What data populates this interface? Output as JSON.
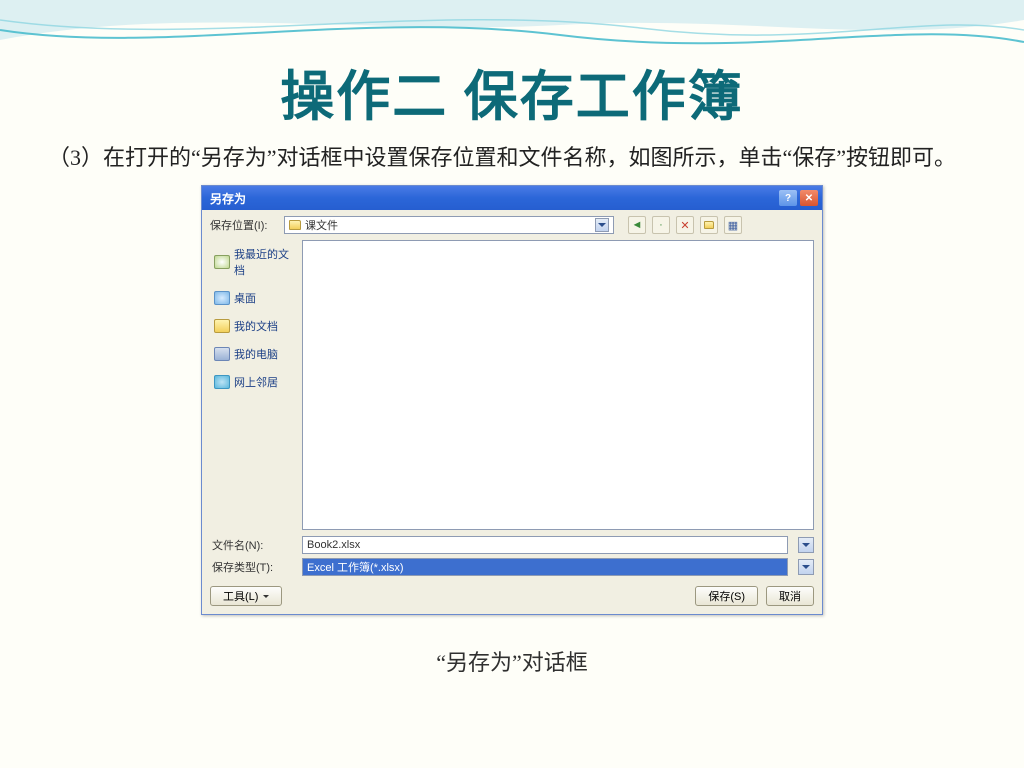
{
  "slide": {
    "title": "操作二 保存工作簿",
    "body": "（3）在打开的“另存为”对话框中设置保存位置和文件名称，如图所示，单击“保存”按钮即可。",
    "caption": "“另存为”对话框"
  },
  "dialog": {
    "title": "另存为",
    "location_label": "保存位置(I):",
    "location_value": "课文件",
    "sidebar": [
      {
        "label": "我最近的文档",
        "icon": "recent"
      },
      {
        "label": "桌面",
        "icon": "desktop"
      },
      {
        "label": "我的文档",
        "icon": "docs"
      },
      {
        "label": "我的电脑",
        "icon": "pc"
      },
      {
        "label": "网上邻居",
        "icon": "net"
      }
    ],
    "filename_label": "文件名(N):",
    "filename_value": "Book2.xlsx",
    "filetype_label": "保存类型(T):",
    "filetype_value": "Excel 工作簿(*.xlsx)",
    "buttons": {
      "tools": "工具(L)",
      "save": "保存(S)",
      "cancel": "取消"
    }
  }
}
